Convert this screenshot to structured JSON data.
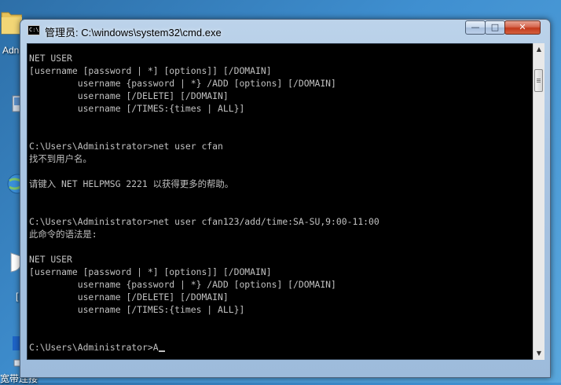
{
  "desktop": {
    "label_admin": "Adn",
    "label_d": "[",
    "label_broadband": "宽带连接"
  },
  "window": {
    "icon_text": "C:\\",
    "title": "管理员: C:\\windows\\system32\\cmd.exe",
    "controls": {
      "minimize": "—",
      "maximize": "□",
      "close": "✕"
    }
  },
  "console": {
    "lines": [
      "NET USER",
      "[username [password | *] [options]] [/DOMAIN]",
      "         username {password | *} /ADD [options] [/DOMAIN]",
      "         username [/DELETE] [/DOMAIN]",
      "         username [/TIMES:{times | ALL}]",
      "",
      "",
      "C:\\Users\\Administrator>net user cfan",
      "找不到用户名。",
      "",
      "请键入 NET HELPMSG 2221 以获得更多的帮助。",
      "",
      "",
      "C:\\Users\\Administrator>net user cfan123/add/time:SA-SU,9:00-11:00",
      "此命令的语法是:",
      "",
      "NET USER",
      "[username [password | *] [options]] [/DOMAIN]",
      "         username {password | *} /ADD [options] [/DOMAIN]",
      "         username [/DELETE] [/DOMAIN]",
      "         username [/TIMES:{times | ALL}]",
      "",
      "",
      "C:\\Users\\Administrator>A"
    ]
  },
  "scrollbar": {
    "up_arrow": "▲",
    "down_arrow": "▼",
    "position": 0.05
  },
  "colors": {
    "console_bg": "#000000",
    "console_fg": "#c0c0c0",
    "close_button": "#c2391b"
  }
}
